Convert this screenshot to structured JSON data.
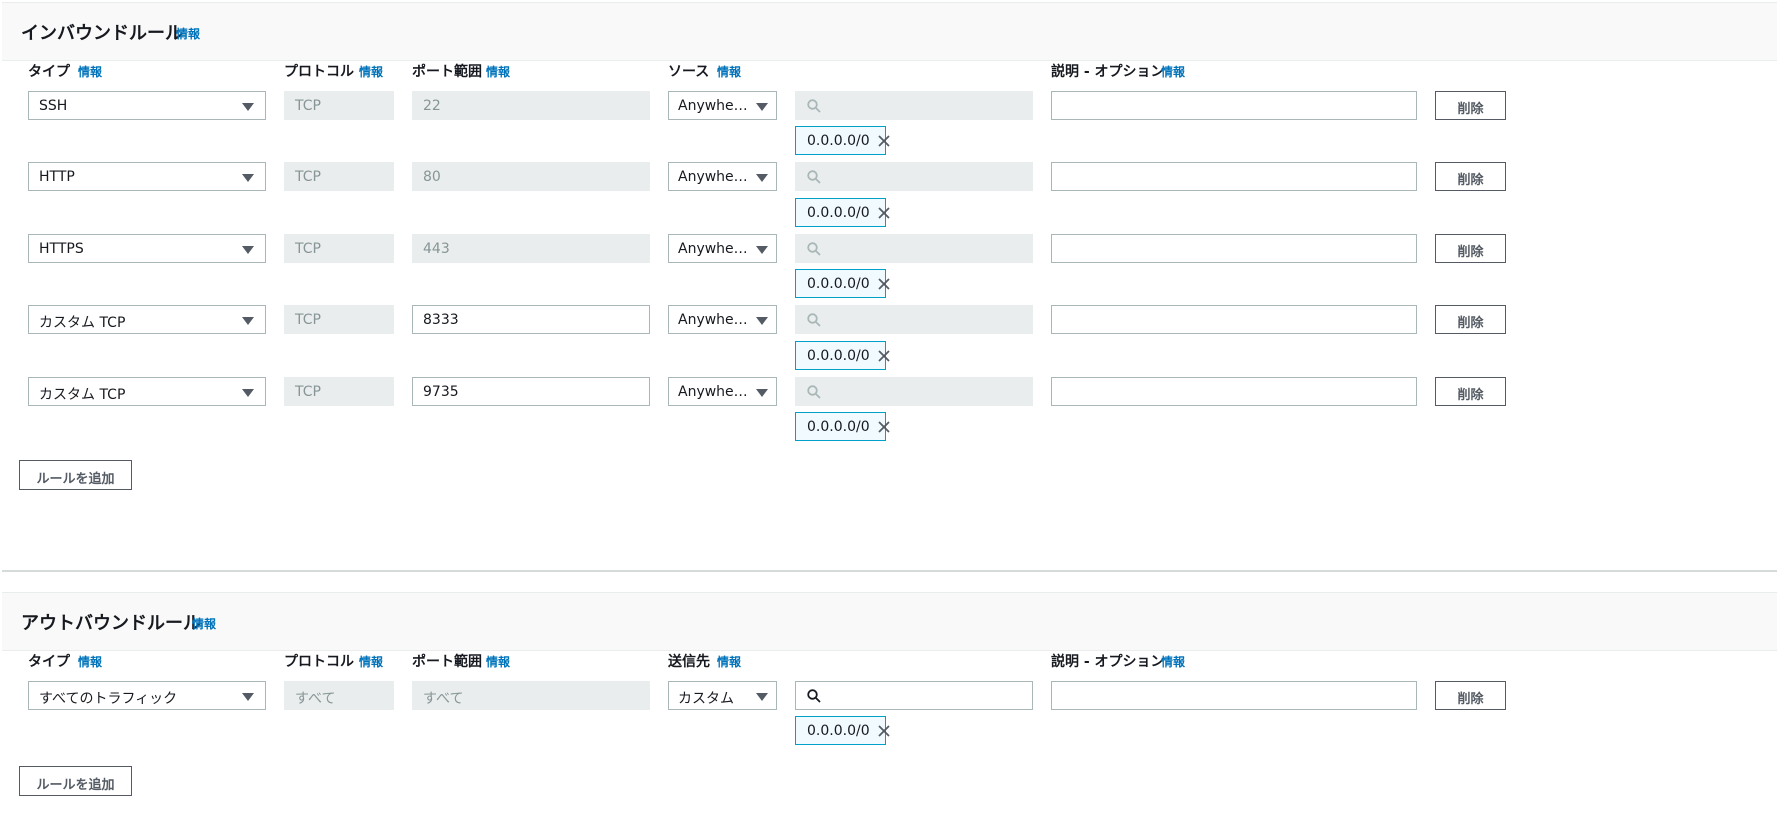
{
  "inbound": {
    "title": "インバウンドルール",
    "title_info": "情報",
    "columns": {
      "type": "タイプ",
      "type_info": "情報",
      "protocol": "プロトコル",
      "protocol_info": "情報",
      "port_range": "ポート範囲",
      "port_range_info": "情報",
      "source": "ソース",
      "source_info": "情報",
      "description": "説明 - オプション",
      "description_info": "情報"
    },
    "rules": [
      {
        "type": "SSH",
        "protocol": "TCP",
        "port_range": "22",
        "source": "Anywhere-I...",
        "cidr": "0.0.0.0/0",
        "description": "",
        "delete_label": "削除"
      },
      {
        "type": "HTTP",
        "protocol": "TCP",
        "port_range": "80",
        "source": "Anywhere-I...",
        "cidr": "0.0.0.0/0",
        "description": "",
        "delete_label": "削除"
      },
      {
        "type": "HTTPS",
        "protocol": "TCP",
        "port_range": "443",
        "source": "Anywhere-I...",
        "cidr": "0.0.0.0/0",
        "description": "",
        "delete_label": "削除"
      },
      {
        "type": "カスタム TCP",
        "protocol": "TCP",
        "port_range": "8333",
        "source": "Anywhere-I...",
        "cidr": "0.0.0.0/0",
        "description": "",
        "delete_label": "削除"
      },
      {
        "type": "カスタム TCP",
        "protocol": "TCP",
        "port_range": "9735",
        "source": "Anywhere-I...",
        "cidr": "0.0.0.0/0",
        "description": "",
        "delete_label": "削除"
      }
    ],
    "add_rule_label": "ルールを追加"
  },
  "outbound": {
    "title": "アウトバウンドルール",
    "title_info": "情報",
    "columns": {
      "type": "タイプ",
      "type_info": "情報",
      "protocol": "プロトコル",
      "protocol_info": "情報",
      "port_range": "ポート範囲",
      "port_range_info": "情報",
      "destination": "送信先",
      "destination_info": "情報",
      "description": "説明 - オプション",
      "description_info": "情報"
    },
    "rules": [
      {
        "type": "すべてのトラフィック",
        "protocol": "すべて",
        "port_range": "すべて",
        "destination": "カスタム",
        "cidr": "0.0.0.0/0",
        "description": "",
        "delete_label": "削除"
      }
    ],
    "add_rule_label": "ルールを追加"
  },
  "icons": {
    "search": "search-icon",
    "remove": "close-icon",
    "dropdown": "caret-down-icon"
  },
  "colors": {
    "info_link": "#0073bb",
    "token_border": "#00a1c9",
    "token_bg": "#f1faff",
    "disabled_bg": "#eaeded",
    "header_bg": "#f9f9f9"
  }
}
